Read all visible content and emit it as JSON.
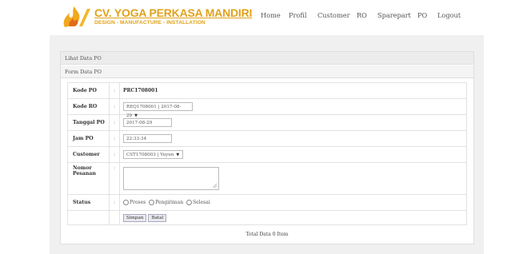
{
  "brand": {
    "title": "CV. YOGA PERKASA MANDIRI",
    "subtitle": "DESIGN - MANUFACTURE - INSTALLATION",
    "color": "#e0a21a"
  },
  "nav": [
    "Home",
    "Profil",
    "Customer",
    "RO",
    "Sparepart",
    "PO",
    "Logout"
  ],
  "breadcrumb": "Lihat Data PO",
  "form_title": "Form Data PO",
  "fields": {
    "kode_po": {
      "label": "Kode PO",
      "value": "PRC1708001"
    },
    "kode_ro": {
      "label": "Kode RO",
      "value": "REQ1708001 | 2017-08-29"
    },
    "tanggal_po": {
      "label": "Tanggal PO",
      "value": "2017-08-29"
    },
    "jam_po": {
      "label": "Jam PO",
      "value": "22:33:34"
    },
    "customer": {
      "label": "Customer",
      "value": "CST1708003 | Yuyun"
    },
    "nomor_pesanan": {
      "label": "Nomor Pesanan",
      "value": ""
    },
    "status": {
      "label": "Status",
      "options": [
        "Proses",
        "Pengiriman",
        "Selesai"
      ]
    }
  },
  "separator": ":",
  "buttons": {
    "save": "Simpan",
    "cancel": "Batal"
  },
  "footer": "Total Data 0 Item"
}
